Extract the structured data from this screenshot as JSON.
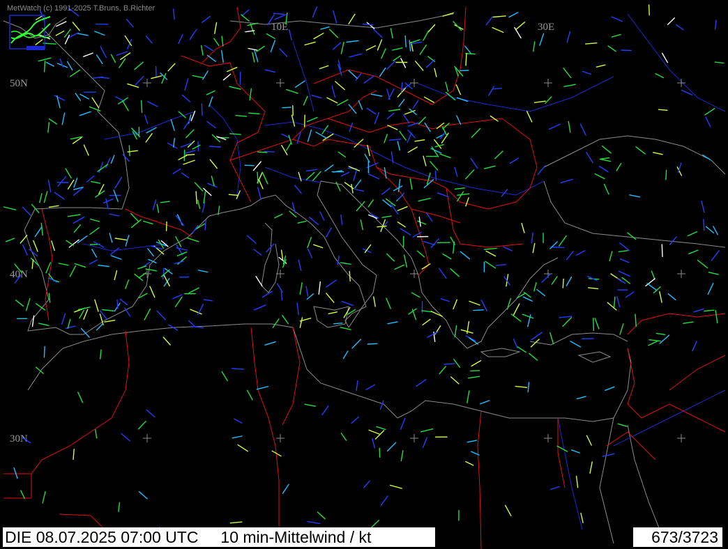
{
  "app": {
    "credit": "MetWatch (c) 1991-2025 T.Bruns, B.Richter"
  },
  "map": {
    "grid_labels": {
      "lon_10e": "10E",
      "lon_30e": "30E",
      "lat_50n": "50N",
      "lat_40n": "40N",
      "lat_30n": "30N"
    },
    "colors": {
      "background": "#000000",
      "coastline": "#8c8c8c",
      "borders": "#e01010",
      "rivers": "#1020c0",
      "grid_cross": "#8c8c8c",
      "wind_calm": "#2040ff",
      "wind_light": "#20c0ff",
      "wind_moderate": "#20e040",
      "wind_fresh": "#d0ff40",
      "wind_strong": "#ffffff",
      "wind_special": "#ff40ff"
    },
    "logo_icon": "metwatch-logo-icon"
  },
  "status": {
    "datetime": "DIE 08.07.2025 07:00 UTC",
    "parameter": "10 min-Mittelwind / kt",
    "count": "673/3723"
  }
}
